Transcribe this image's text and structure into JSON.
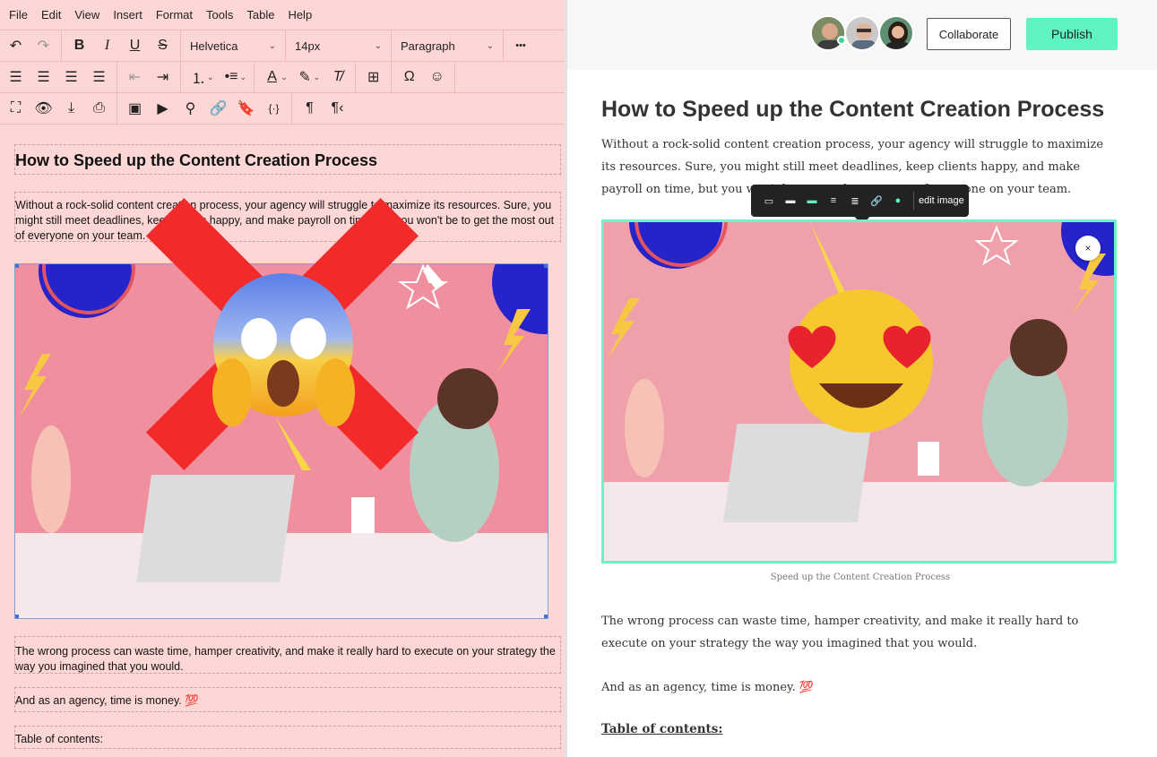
{
  "menu": [
    "File",
    "Edit",
    "View",
    "Insert",
    "Format",
    "Tools",
    "Table",
    "Help"
  ],
  "toolbar": {
    "font_family": "Helvetica",
    "font_size": "14px",
    "block_format": "Paragraph",
    "more": "•••"
  },
  "editor": {
    "heading": "How to Speed up the Content Creation Process",
    "intro": "Without a rock-solid content creation process, your agency will struggle to maximize its resources. Sure, you might still meet deadlines, keep clients happy, and make payroll on time, but you won't be to get the most out of everyone on your team.",
    "para2": "The wrong process can waste time, hamper creativity, and make it really hard to execute on your strategy the way you imagined that you would.",
    "para3": "And as an agency, time is money. 💯",
    "toc": "Table of contents:"
  },
  "preview": {
    "collaborate_label": "Collaborate",
    "publish_label": "Publish",
    "title": "How to Speed up the Content Creation Process",
    "intro": "Without a rock-solid content creation process, your agency will struggle to maximize its resources. Sure, you might still meet deadlines, keep clients happy, and make payroll on time, but you won't be to get the most out of everyone on your team.",
    "image_toolbar_edit": "edit image",
    "close": "×",
    "caption": "Speed up the Content Creation Process",
    "para2": "The wrong process can waste time, hamper creativity, and make it really hard to execute on your strategy the way you imagined that you would.",
    "para3": "And as an agency, time is money. 💯",
    "toc": "Table of contents:"
  },
  "colors": {
    "editor_bg": "#fdd6d6",
    "publish": "#5ff5c0",
    "image_frame": "#6ff0c8",
    "cross": "#f22a2a"
  }
}
